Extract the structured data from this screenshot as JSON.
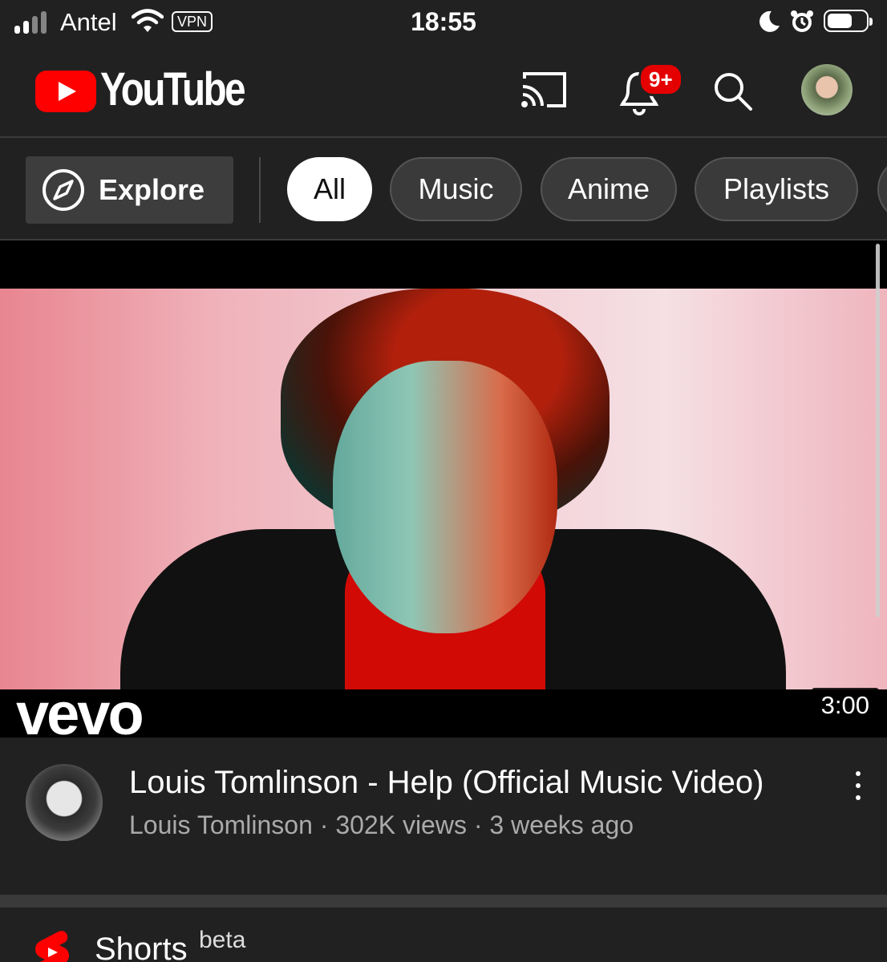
{
  "status_bar": {
    "carrier": "Antel",
    "vpn": "VPN",
    "time": "18:55"
  },
  "header": {
    "logo_text": "YouTube",
    "notification_badge": "9+"
  },
  "chips": {
    "explore_label": "Explore",
    "items": [
      "All",
      "Music",
      "Anime",
      "Playlists"
    ],
    "active": "All"
  },
  "video": {
    "watermark": "vevo",
    "duration": "3:00",
    "title": "Louis Tomlinson - Help (Official Music Video)",
    "channel": "Louis Tomlinson",
    "views": "302K views",
    "age": "3 weeks ago",
    "subtitle": "Louis Tomlinson · 302K views · 3 weeks ago"
  },
  "shorts": {
    "label": "Shorts",
    "badge": "beta"
  },
  "colors": {
    "background": "#212121",
    "brand_red": "#ff0000",
    "badge_red": "#e50000",
    "chip_bg": "#3a3a3a",
    "secondary_text": "#aaaaaa"
  },
  "icons": [
    "signal-icon",
    "wifi-icon",
    "moon-icon",
    "alarm-icon",
    "battery-icon",
    "cast-icon",
    "bell-icon",
    "search-icon",
    "compass-icon",
    "more-vert-icon",
    "shorts-icon"
  ]
}
